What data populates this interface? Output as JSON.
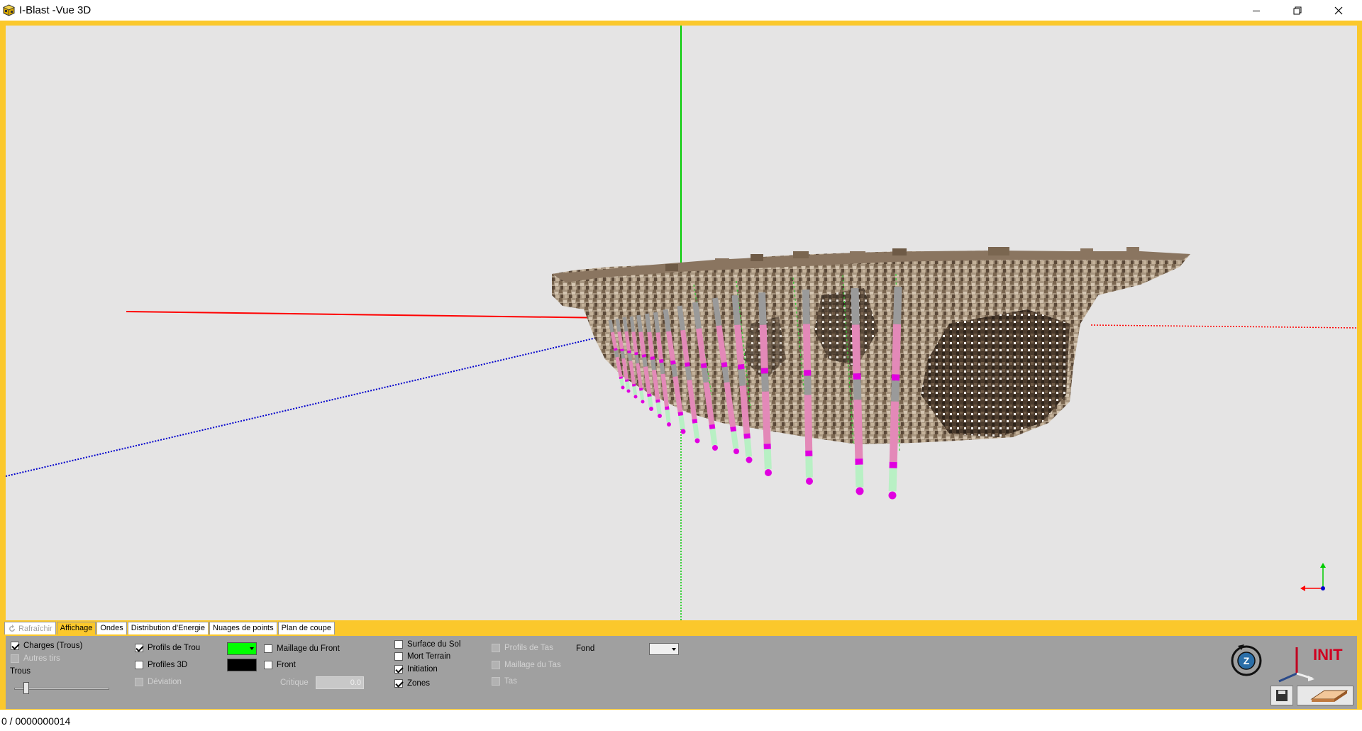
{
  "window": {
    "title": "I-Blast -Vue 3D",
    "controls": [
      "minimize-icon",
      "restore-icon",
      "close-icon"
    ]
  },
  "viewport": {
    "background": "#e5e4e4",
    "axis_colors": {
      "x": "#ff0000",
      "y": "#00cc00",
      "z": "#0000cc"
    },
    "hole_colors": {
      "stemming": "#9a9a9a",
      "charge": "#e389b8",
      "primer": "#e000e0",
      "subdrill": "#b8f0c4"
    }
  },
  "tabs": {
    "refresh": "Rafraîchir",
    "items": [
      "Affichage",
      "Ondes",
      "Distribution d'Energie",
      "Nuages de points",
      "Plan de coupe"
    ],
    "active": "Affichage"
  },
  "panel": {
    "charges": "Charges (Trous)",
    "autres_tirs": "Autres tirs",
    "trous": "Trous",
    "trous_slider_fraction": 0.13,
    "profils_trou": "Profils de Trou",
    "profiles_3d": "Profiles 3D",
    "deviation": "Déviation",
    "maillage_front": "Maillage du Front",
    "front": "Front",
    "critique": "Critique",
    "critique_value": "0.0",
    "surface_sol": "Surface du Sol",
    "mort_terrain": "Mort Terrain",
    "initiation": "Initiation",
    "zones": "Zones",
    "profils_tas": "Profils de Tas",
    "maillage_tas": "Maillage du Tas",
    "tas": "Tas",
    "fond": "Fond",
    "init_label": "INIT",
    "profile_color": "#00ff00",
    "front_color": "#000000"
  },
  "status": {
    "text": "0 / 0000000014"
  }
}
